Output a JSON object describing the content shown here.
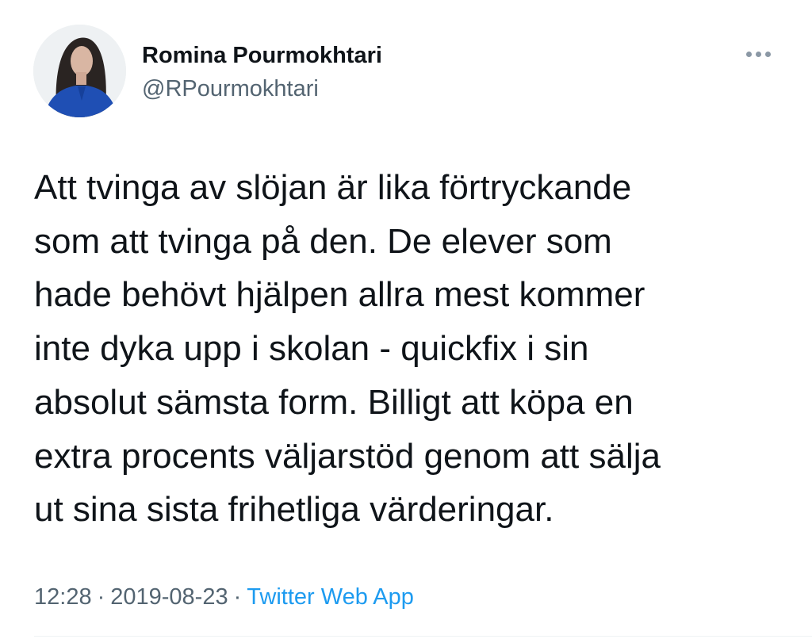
{
  "author": {
    "name": "Romina Pourmokhtari",
    "handle": "@RPourmokhtari",
    "avatar_icon": "profile-photo"
  },
  "more_icon": "ellipsis-icon",
  "tweet": {
    "lines": [
      "Att tvinga av slöjan är lika förtryckande",
      "som att tvinga på den. De elever som",
      "hade behövt hjälpen allra mest kommer",
      "inte dyka upp i skolan - quickfix i sin",
      "absolut sämsta form. Billigt att köpa en",
      "extra procents väljarstöd genom att sälja",
      "ut sina sista frihetliga värderingar."
    ]
  },
  "meta": {
    "time": "12:28",
    "separator": "·",
    "date": "2019-08-23",
    "source": "Twitter Web App"
  },
  "colors": {
    "text_primary": "#0f1419",
    "text_secondary": "#536471",
    "link": "#1d9bf0",
    "avatar_shirt": "#1f4fb4"
  }
}
